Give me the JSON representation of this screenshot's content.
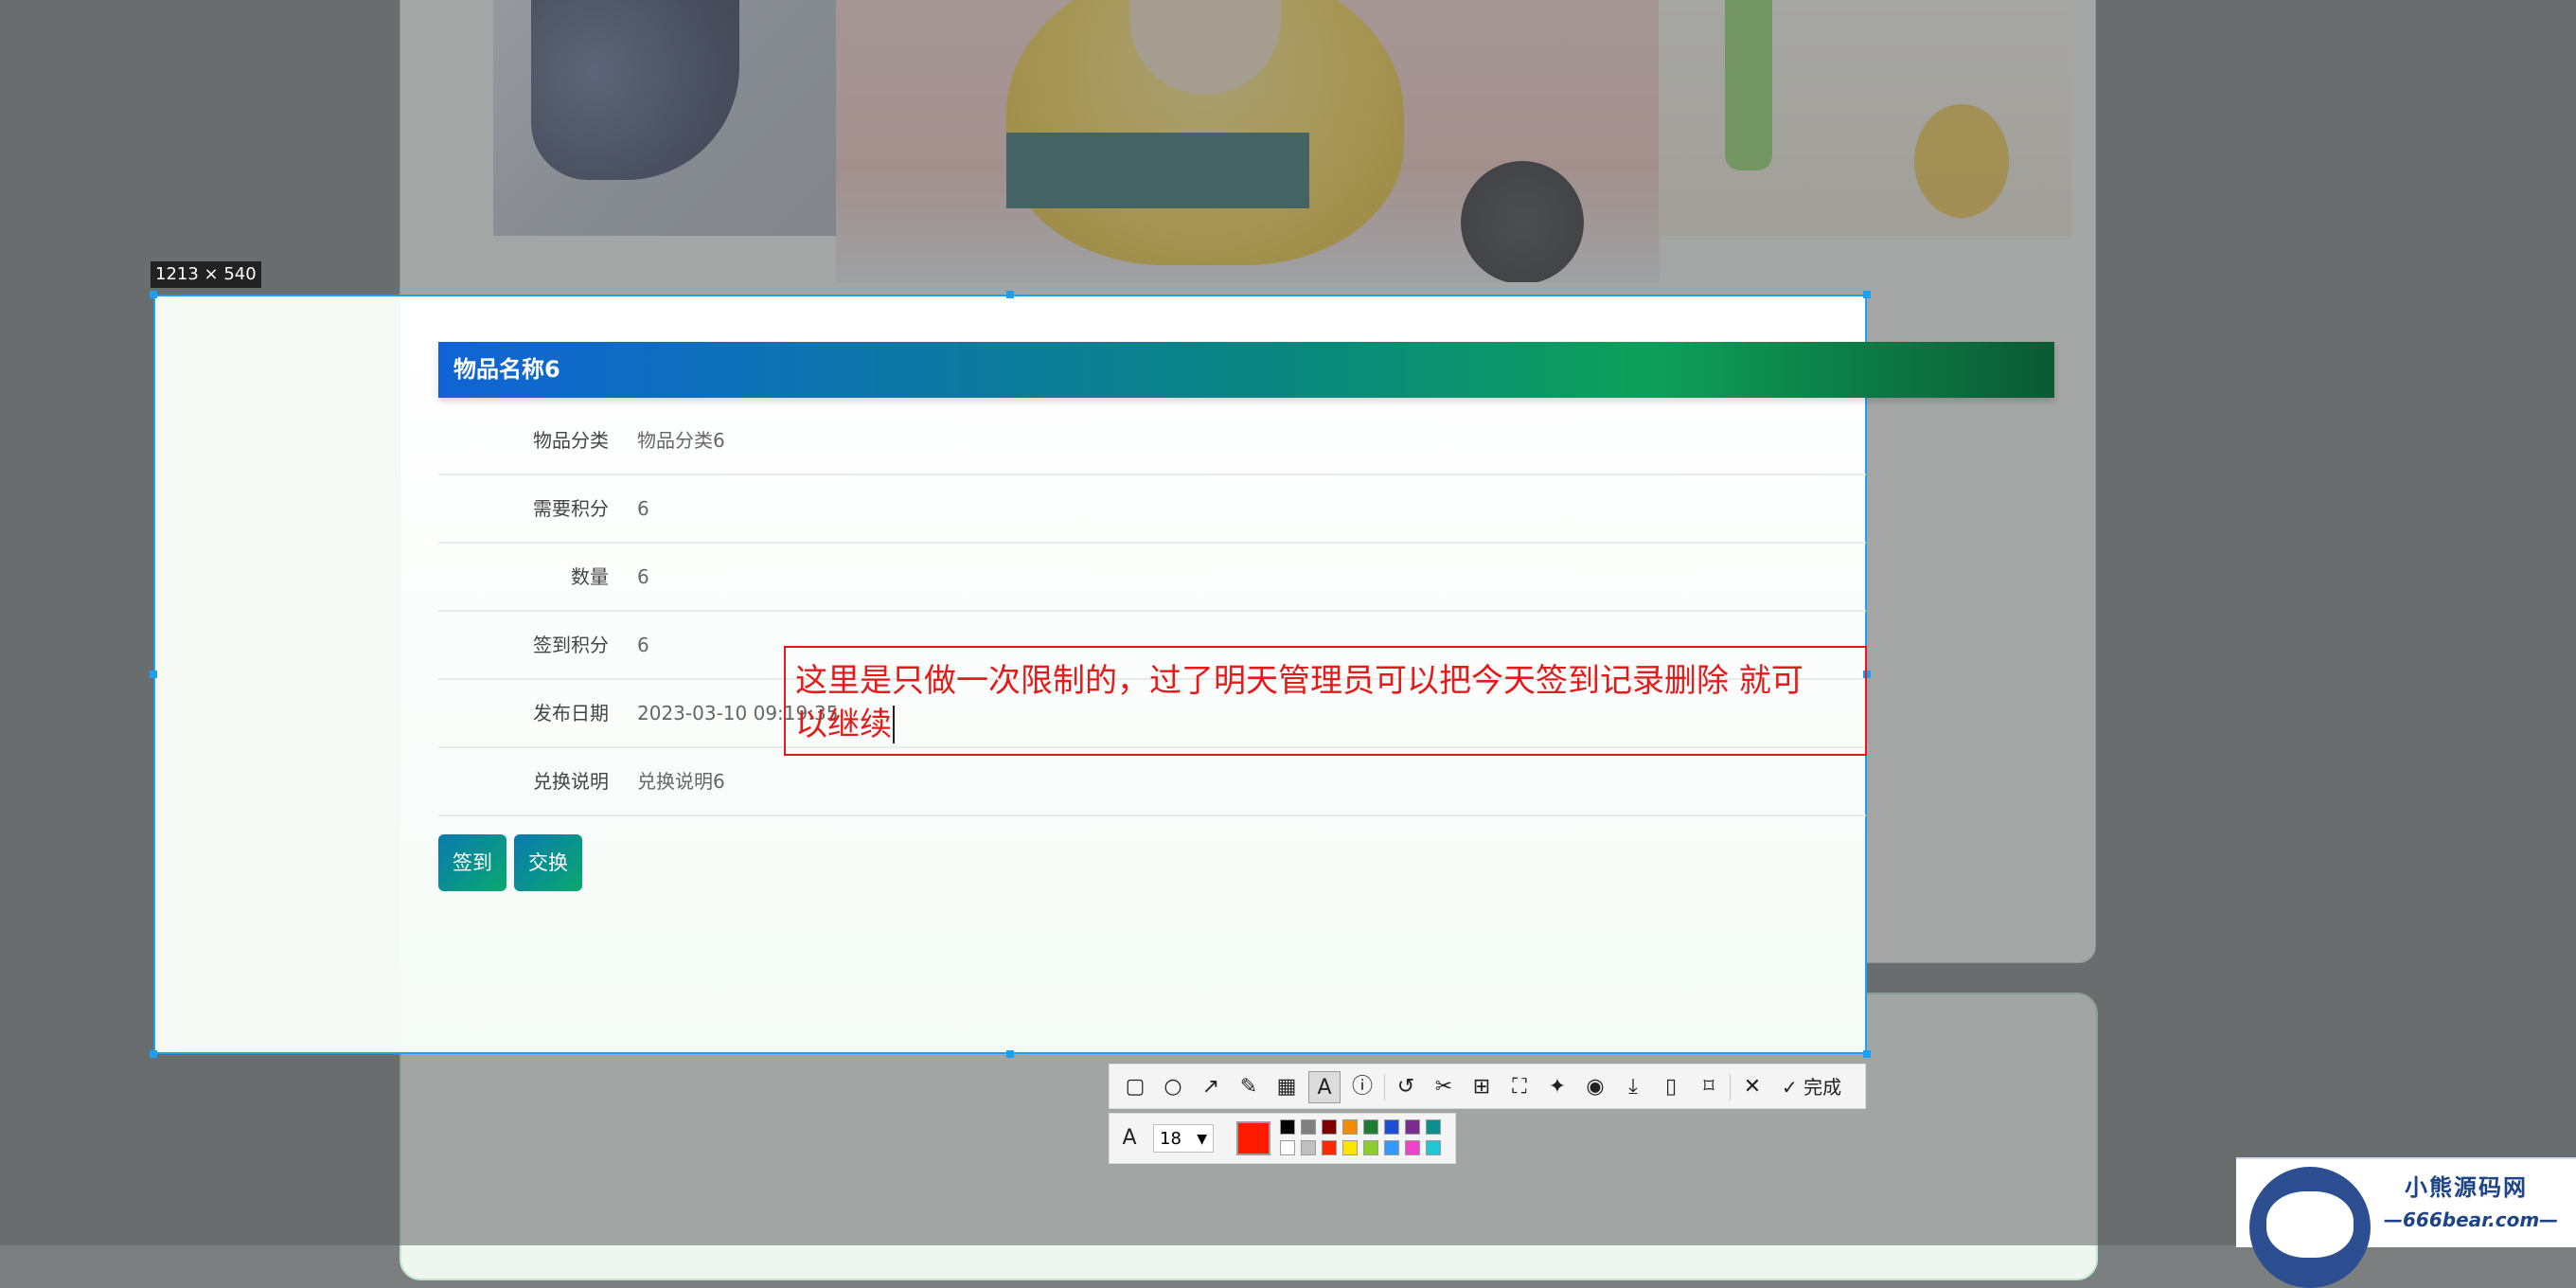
{
  "selection": {
    "size_label": "1213 × 540"
  },
  "item": {
    "title": "物品名称6",
    "rows": [
      {
        "label": "物品分类",
        "value": "物品分类6"
      },
      {
        "label": "需要积分",
        "value": "6"
      },
      {
        "label": "数量",
        "value": "6"
      },
      {
        "label": "签到积分",
        "value": "6"
      },
      {
        "label": "发布日期",
        "value": "2023-03-10 09:19:35"
      },
      {
        "label": "兑换说明",
        "value": "兑换说明6"
      }
    ],
    "buttons": {
      "checkin": "签到",
      "exchange": "交换"
    }
  },
  "annotation": {
    "line1": "这里是只做一次限制的，过了明天管理员可以把今天签到记录删除 就可",
    "line2": "以继续"
  },
  "toolbar": {
    "done_label": "完成",
    "icons": [
      "rectangle-icon",
      "ellipse-icon",
      "arrow-icon",
      "pencil-icon",
      "mosaic-icon",
      "text-icon",
      "number-icon",
      "undo-icon",
      "cut-icon",
      "ocr-icon",
      "scroll-capture-icon",
      "pin-icon",
      "record-icon",
      "download-icon",
      "phone-icon",
      "bookmark-icon",
      "close-icon",
      "check-icon"
    ],
    "font_size": "18",
    "current_color": "#ff1a00",
    "palette": [
      "#000000",
      "#808080",
      "#800000",
      "#f08c00",
      "#1e7d32",
      "#1e4fd4",
      "#7c2d8e",
      "#0e8f8f",
      "#ffffff",
      "#c0c0c0",
      "#ff2a00",
      "#ffe400",
      "#8ccf2a",
      "#3399ff",
      "#ee44cc",
      "#22c7d6"
    ]
  },
  "watermark": {
    "title": "小熊源码网",
    "url": "—666bear.com—"
  }
}
